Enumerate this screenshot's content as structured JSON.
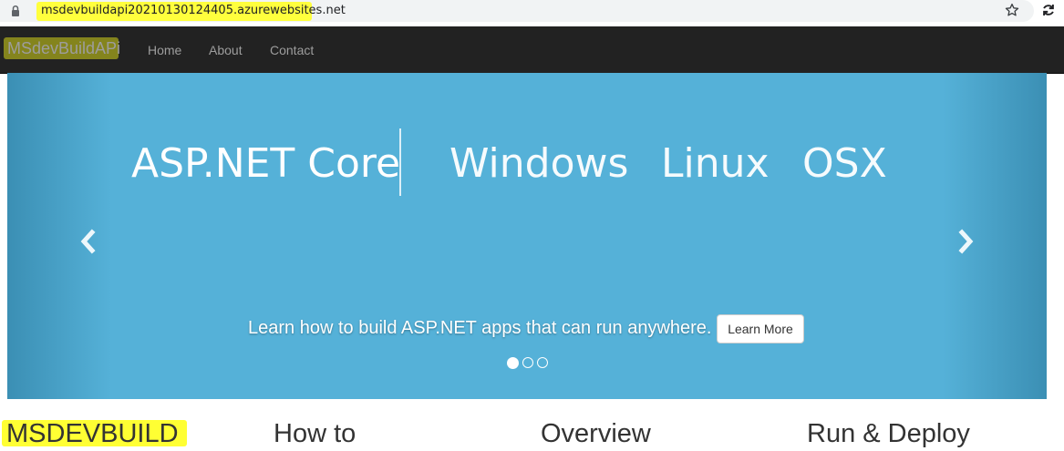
{
  "browser": {
    "url": "msdevbuildapi20210130124405.azurewebsites.net",
    "icons": [
      "lock-icon",
      "star-icon",
      "sync-icon"
    ]
  },
  "navbar": {
    "brand": "MSdevBuildAPi",
    "items": [
      "Home",
      "About",
      "Contact"
    ]
  },
  "carousel": {
    "headline": {
      "main": "ASP.NET Core",
      "platforms": [
        "Windows",
        "Linux",
        "OSX"
      ]
    },
    "caption": "Learn how to build ASP.NET apps that can run anywhere.",
    "button_label": "Learn More",
    "slide_count": 3,
    "active_slide": 1,
    "icons": [
      "chevron-left-icon",
      "chevron-right-icon"
    ]
  },
  "columns": [
    "MSDEVBUILD",
    "How to",
    "Overview",
    "Run & Deploy"
  ],
  "colors": {
    "highlight": "#ffff33",
    "navbar": "#222222",
    "carousel": "#55b1d8"
  }
}
